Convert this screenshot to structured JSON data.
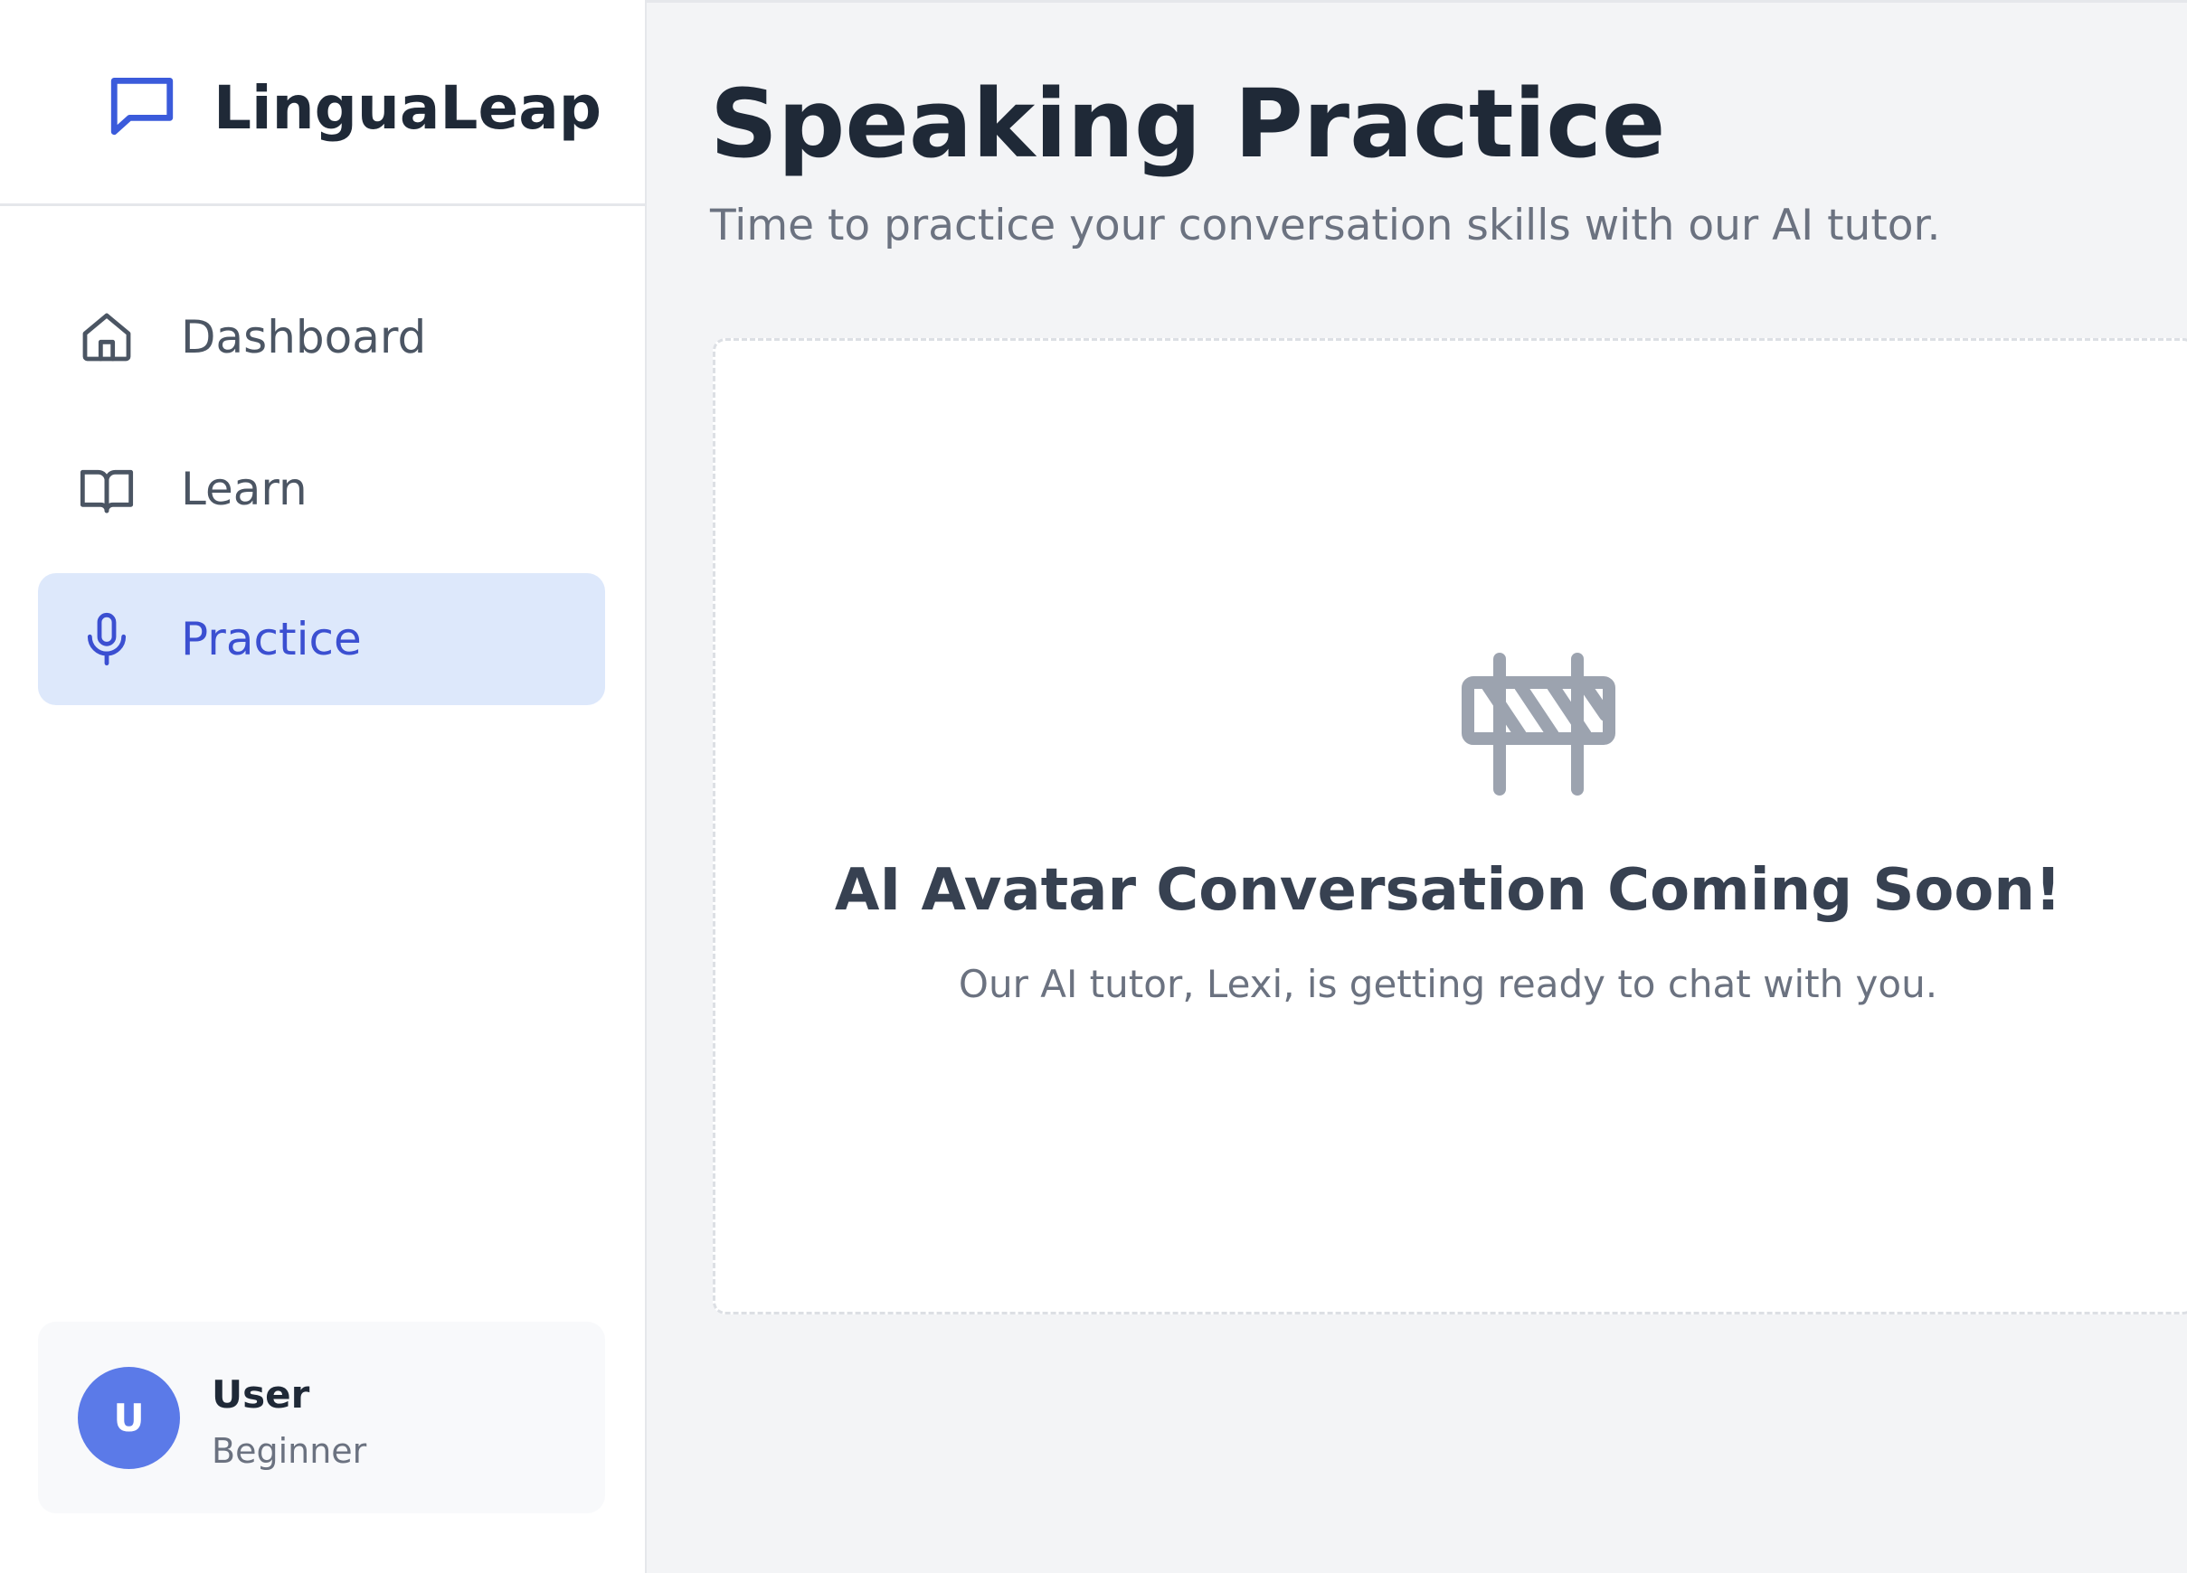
{
  "brand": {
    "name": "LinguaLeap",
    "icon": "chat-bubble-icon"
  },
  "nav": {
    "items": [
      {
        "label": "Dashboard",
        "icon": "home-icon",
        "active": false
      },
      {
        "label": "Learn",
        "icon": "book-open-icon",
        "active": false
      },
      {
        "label": "Practice",
        "icon": "microphone-icon",
        "active": true
      }
    ]
  },
  "user": {
    "initial": "U",
    "name": "User",
    "level": "Beginner"
  },
  "header": {
    "title": "Speaking Practice",
    "subtitle": "Time to practice your conversation skills with our AI tutor."
  },
  "placeholder": {
    "icon": "construction-barrier-icon",
    "title": "AI Avatar Conversation Coming Soon!",
    "text": "Our AI tutor, Lexi, is getting ready to chat with you."
  },
  "colors": {
    "accent": "#3b4fd1",
    "active_bg": "#dde8fb",
    "avatar_bg": "#5b7ae8",
    "icon_gray": "#9ca3af"
  }
}
